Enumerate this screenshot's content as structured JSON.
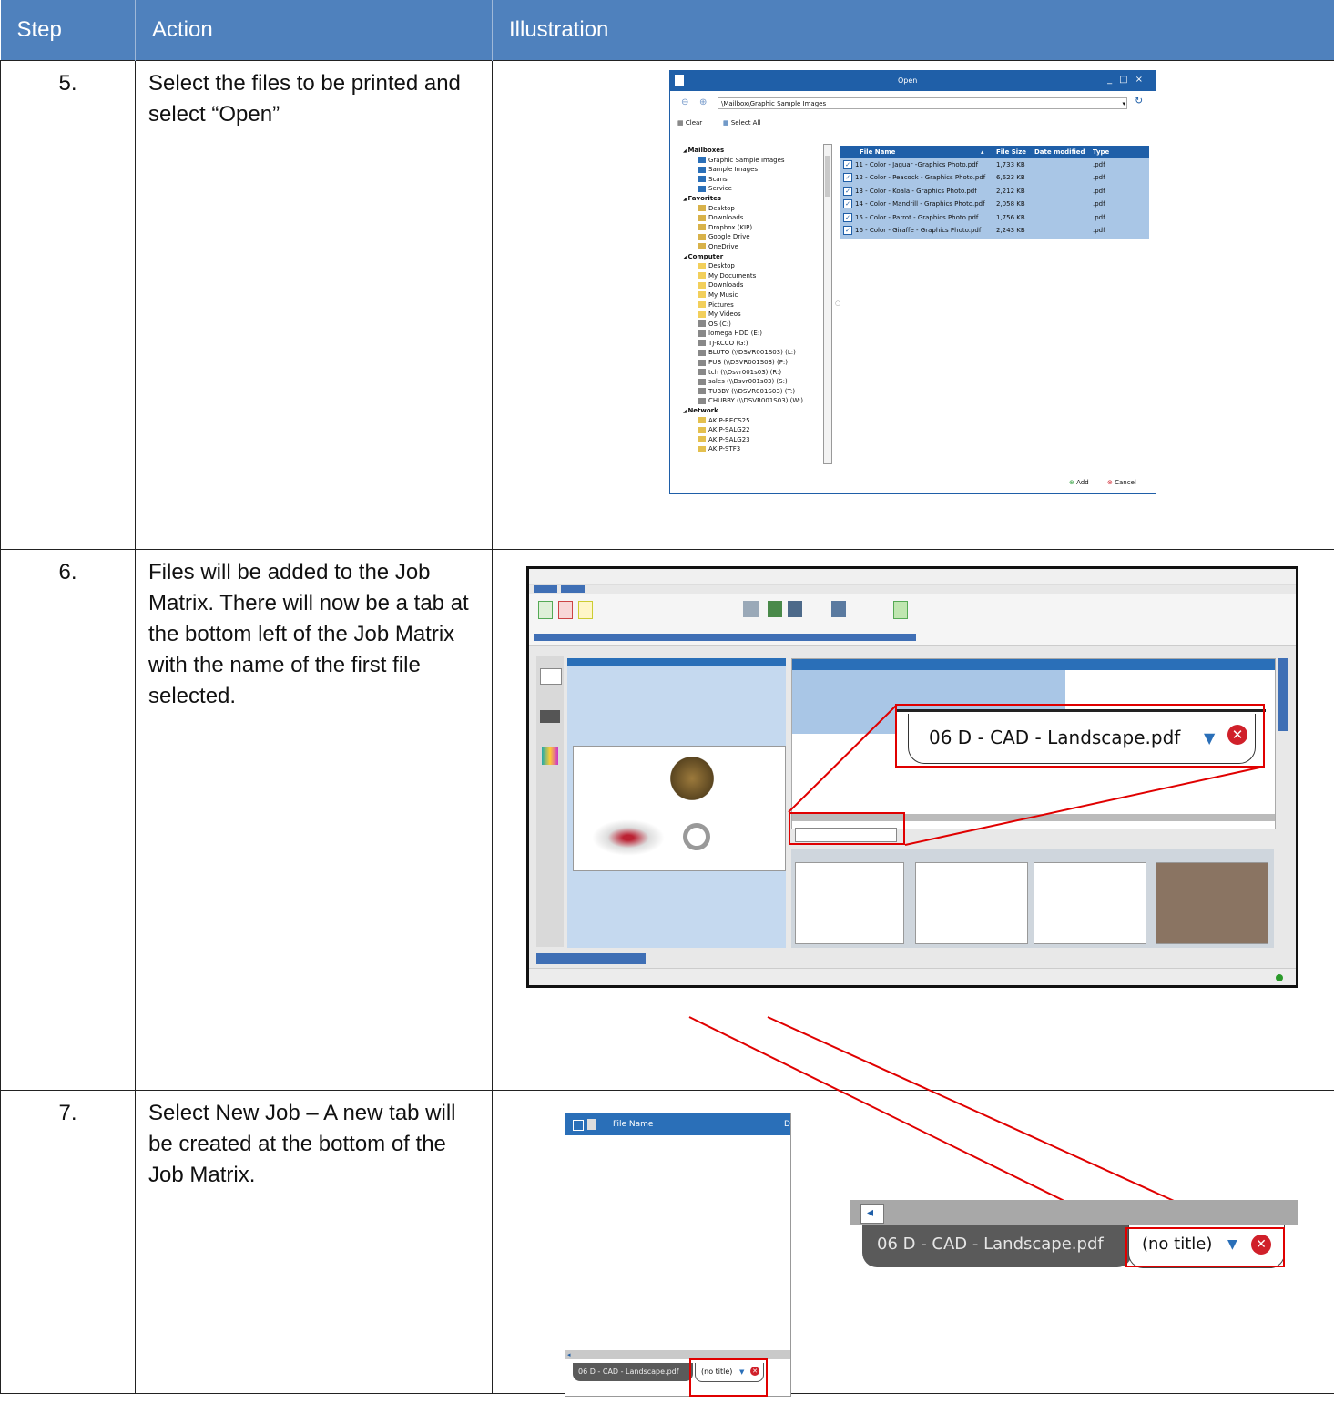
{
  "table": {
    "headers": {
      "step": "Step",
      "action": "Action",
      "illustration": "Illustration"
    },
    "rows": [
      {
        "step": "5.",
        "action": "Select the files to be printed and select “Open”"
      },
      {
        "step": "6.",
        "action": "Files will be added to the Job Matrix. There will now be a tab at the bottom left of the Job Matrix with the name of the first file selected."
      },
      {
        "step": "7.",
        "action": "Select New Job – A new tab will be created at the bottom of the Job Matrix."
      }
    ]
  },
  "open_dialog": {
    "title": "Open",
    "path": "\\Mailbox\\Graphic Sample Images",
    "clear_label": "Clear",
    "select_all_label": "Select All",
    "tree": [
      {
        "label": "Mailboxes",
        "heading": true
      },
      {
        "label": "Graphic Sample Images",
        "icon": "mailbox-folder"
      },
      {
        "label": "Sample Images",
        "icon": "mailbox-folder"
      },
      {
        "label": "Scans",
        "icon": "mailbox-folder"
      },
      {
        "label": "Service",
        "icon": "mailbox-folder"
      },
      {
        "label": "Favorites",
        "heading": true
      },
      {
        "label": "Desktop",
        "icon": "star-folder"
      },
      {
        "label": "Downloads",
        "icon": "star-folder"
      },
      {
        "label": "Dropbox (KIP)",
        "icon": "star-folder"
      },
      {
        "label": "Google Drive",
        "icon": "star-folder"
      },
      {
        "label": "OneDrive",
        "icon": "star-folder"
      },
      {
        "label": "Computer",
        "heading": true
      },
      {
        "label": "Desktop",
        "icon": "folder"
      },
      {
        "label": "My Documents",
        "icon": "folder"
      },
      {
        "label": "Downloads",
        "icon": "folder"
      },
      {
        "label": "My Music",
        "icon": "folder"
      },
      {
        "label": "Pictures",
        "icon": "folder"
      },
      {
        "label": "My Videos",
        "icon": "folder"
      },
      {
        "label": "OS (C:)",
        "icon": "drive"
      },
      {
        "label": "Iomega HDD (E:)",
        "icon": "drive"
      },
      {
        "label": "TJ-KCCO (G:)",
        "icon": "drive"
      },
      {
        "label": "BLUTO (\\\\DSVR001S03) (L:)",
        "icon": "drive"
      },
      {
        "label": "PUB (\\\\DSVR001S03) (P:)",
        "icon": "drive"
      },
      {
        "label": "tch (\\\\Dsvr001s03) (R:)",
        "icon": "drive"
      },
      {
        "label": "sales (\\\\Dsvr001s03) (S:)",
        "icon": "drive"
      },
      {
        "label": "TUBBY (\\\\DSVR001S03) (T:)",
        "icon": "drive"
      },
      {
        "label": "CHUBBY (\\\\DSVR001S03) (W:)",
        "icon": "drive"
      },
      {
        "label": "Network",
        "heading": true
      },
      {
        "label": "AKIP-RECS25",
        "icon": "computer"
      },
      {
        "label": "AKIP-SALG22",
        "icon": "computer"
      },
      {
        "label": "AKIP-SALG23",
        "icon": "computer"
      },
      {
        "label": "AKIP-STF3",
        "icon": "computer"
      }
    ],
    "columns": {
      "name": "File Name",
      "size": "File Size",
      "modified": "Date modified",
      "type": "Type"
    },
    "files": [
      {
        "name": "11 - Color - Jaguar -Graphics Photo.pdf",
        "size": "1,733 KB",
        "type": ".pdf"
      },
      {
        "name": "12 - Color - Peacock - Graphics Photo.pdf",
        "size": "6,623 KB",
        "type": ".pdf"
      },
      {
        "name": "13 - Color - Koala - Graphics Photo.pdf",
        "size": "2,212 KB",
        "type": ".pdf"
      },
      {
        "name": "14 - Color - Mandrill - Graphics Photo.pdf",
        "size": "2,058 KB",
        "type": ".pdf"
      },
      {
        "name": "15 - Color - Parrot - Graphics Photo.pdf",
        "size": "1,756 KB",
        "type": ".pdf"
      },
      {
        "name": "16 - Color - Giraffe - Graphics Photo.pdf",
        "size": "2,243 KB",
        "type": ".pdf"
      }
    ],
    "add_label": "Add",
    "cancel_label": "Cancel"
  },
  "job_matrix": {
    "tab_label": "06 D - CAD - Landscape.pdf",
    "colors": {
      "ribbon_blue": "#3f6fb5",
      "list_header": "#2a6fb8",
      "tab_close": "#d0202a"
    }
  },
  "new_job": {
    "list_header": "File Name",
    "header_cut": "D",
    "first_tab": "06 D - CAD - Landscape.pdf",
    "new_tab": "(no title)"
  },
  "colors": {
    "header_bg": "#4f81bd",
    "highlight": "#e00000",
    "dialog_blue": "#1f5fa8"
  }
}
